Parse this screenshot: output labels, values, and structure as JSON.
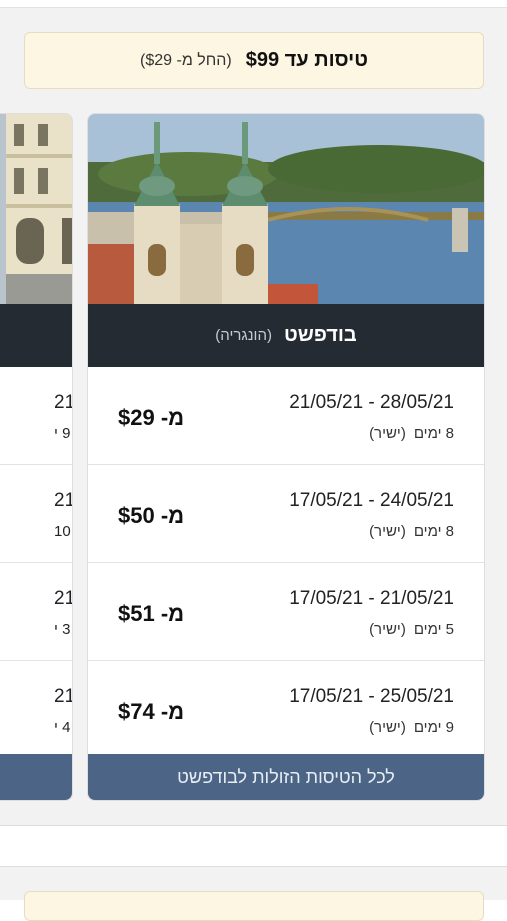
{
  "banner": {
    "title": "טיסות עד $99",
    "subtitle": "(החל מ- $29)"
  },
  "main_card": {
    "city": "בודפשט",
    "country": "(הונגריה)",
    "photo": "budapest-church-river-bridge-photo",
    "deals": [
      {
        "dates": "21/05/21  -  28/05/21",
        "days": "8 ימים",
        "type": "(ישיר)",
        "price": "מ- $29"
      },
      {
        "dates": "17/05/21  -  24/05/21",
        "days": "8 ימים",
        "type": "(ישיר)",
        "price": "מ- $50"
      },
      {
        "dates": "17/05/21  -  21/05/21",
        "days": "5 ימים",
        "type": "(ישיר)",
        "price": "מ- $51"
      },
      {
        "dates": "17/05/21  -  25/05/21",
        "days": "9 ימים",
        "type": "(ישיר)",
        "price": "מ- $74"
      }
    ],
    "footer_label": "לכל הטיסות הזולות לבודפשט"
  },
  "peek_card": {
    "photo": "city-building-facade-photo",
    "deals": [
      {
        "date_fragment": "21",
        "days_fragment": "9 י"
      },
      {
        "date_fragment": "21",
        "days_fragment": "10"
      },
      {
        "date_fragment": "21",
        "days_fragment": "3 י"
      },
      {
        "date_fragment": "21",
        "days_fragment": "4 י"
      }
    ]
  },
  "colors": {
    "banner_bg": "#fcf6e2",
    "city_bar": "#252b33",
    "footer_button": "#4c6586",
    "section_bg": "#f2f2f2"
  }
}
